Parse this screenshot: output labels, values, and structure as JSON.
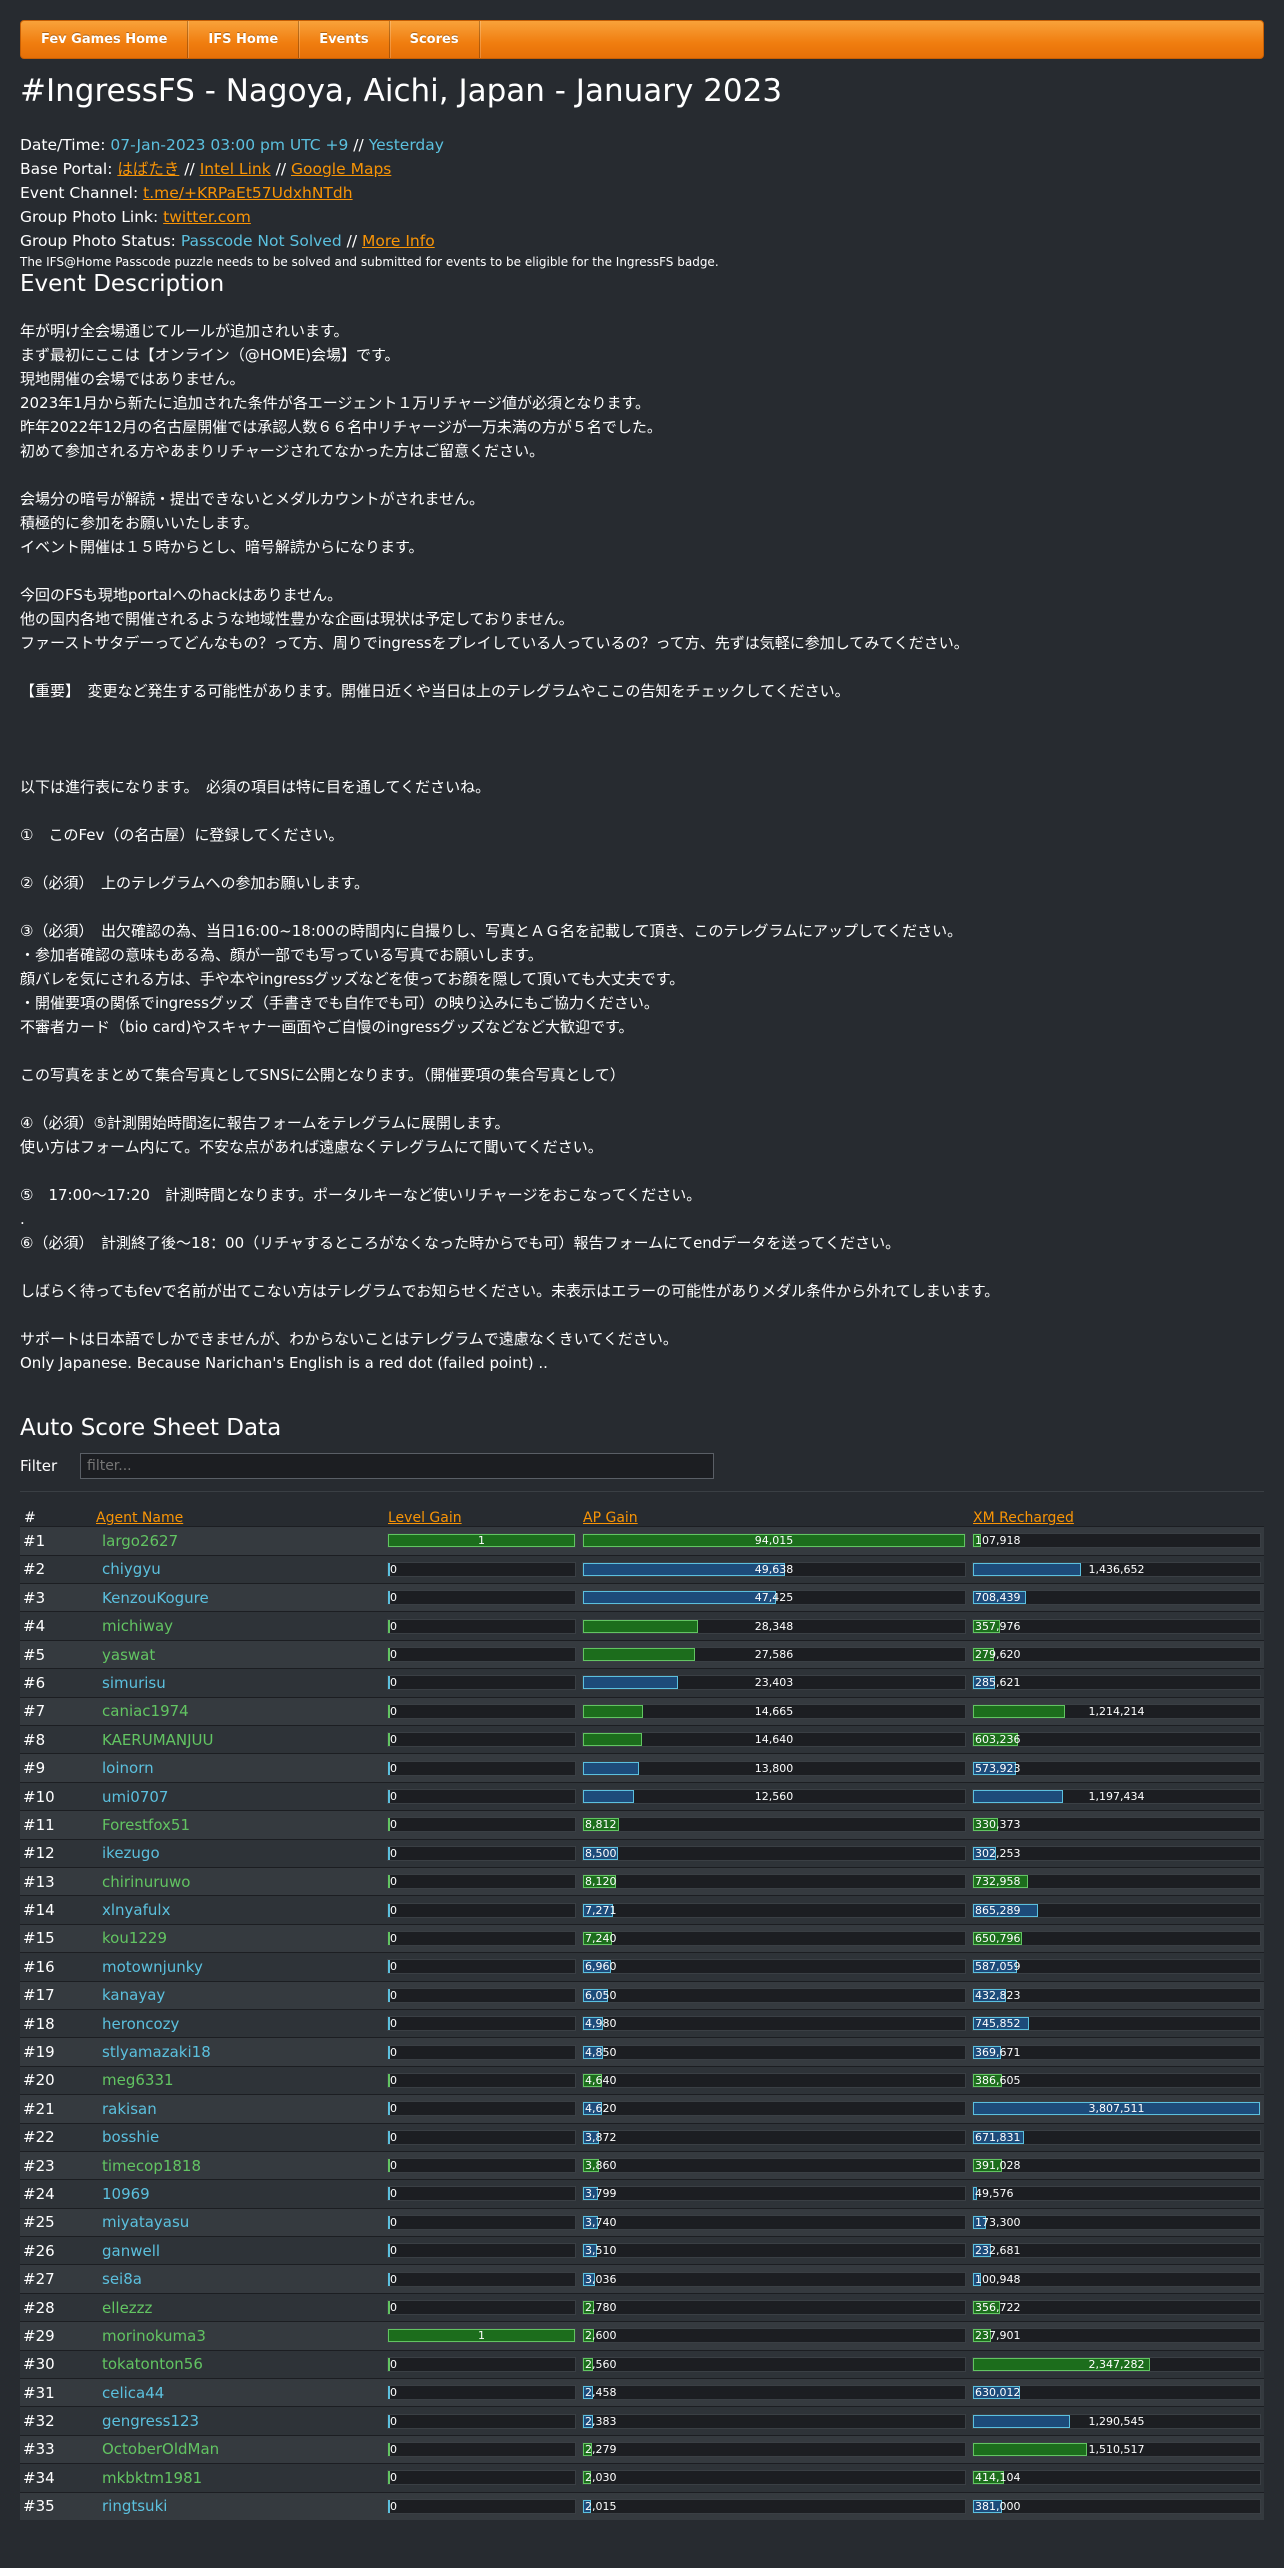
{
  "nav": [
    "Fev Games Home",
    "IFS Home",
    "Events",
    "Scores"
  ],
  "page_title": "#IngressFS - Nagoya, Aichi, Japan - January 2023",
  "info": {
    "datetime_label": "Date/Time: ",
    "datetime_value": "07-Jan-2023 03:00 pm UTC +9",
    "datetime_sep": " // ",
    "datetime_rel": "Yesterday",
    "portal_label": "Base Portal: ",
    "portal_name": "はばたき",
    "sep": " // ",
    "intel_link": "Intel Link",
    "maps_link": "Google Maps",
    "channel_label": "Event Channel: ",
    "channel_link": "t.me/+KRPaEt57UdxhNTdh",
    "photo_label": "Group Photo Link: ",
    "photo_link": "twitter.com",
    "status_label": "Group Photo Status: ",
    "status_value": "Passcode Not Solved",
    "more_info": "More Info",
    "note": "The IFS@Home Passcode puzzle needs to be solved and submitted for events to be eligible for the IngressFS badge."
  },
  "description_heading": "Event Description",
  "description": [
    "年が明け全会場通じてルールが追加されいます。",
    "まず最初にここは【オンライン（@HOME)会場】です。",
    "現地開催の会場ではありません。",
    "2023年1月から新たに追加された条件が各エージェント１万リチャージ値が必須となります。",
    "昨年2022年12月の名古屋開催では承認人数６６名中リチャージが一万未満の方が５名でした。",
    "初めて参加される方やあまりリチャージされてなかった方はご留意ください。",
    "",
    "会場分の暗号が解読・提出できないとメダルカウントがされません。",
    "積極的に参加をお願いいたします。",
    "イベント開催は１５時からとし、暗号解読からになります。",
    "",
    "今回のFSも現地portalへのhackはありません。",
    "他の国内各地で開催されるような地域性豊かな企画は現状は予定しておりません。",
    "ファーストサタデーってどんなもの？って方、周りでingressをプレイしている人っているの？って方、先ずは気軽に参加してみてください。",
    "",
    "【重要】　変更など発生する可能性があります。開催日近くや当日は上のテレグラムやここの告知をチェックしてください。",
    "",
    "",
    "",
    "以下は進行表になります。　必須の項目は特に目を通してくださいね。",
    "",
    "①　このFev（の名古屋）に登録してください。",
    "",
    "②（必須）　上のテレグラムへの参加お願いします。",
    "",
    "③（必須）　出欠確認の為、当日16:00~18:00の時間内に自撮りし、写真とＡＧ名を記載して頂き、このテレグラムにアップしてください。",
    "・参加者確認の意味もある為、顔が一部でも写っている写真でお願いします。",
    "顔バレを気にされる方は、手や本やingressグッズなどを使ってお顔を隠して頂いても大丈夫です。",
    "・開催要項の関係でingressグッズ（手書きでも自作でも可）の映り込みにもご協力ください。",
    "不審者カード（bio card)やスキャナー画面やご自慢のingressグッズなどなど大歓迎です。",
    "",
    "この写真をまとめて集合写真としてSNSに公開となります。（開催要項の集合写真として）",
    "",
    "④（必須）⑤計測開始時間迄に報告フォームをテレグラムに展開します。",
    "使い方はフォーム内にて。不安な点があれば遠慮なくテレグラムにて聞いてください。",
    "",
    "⑤　17:00～17:20　計測時間となります。ポータルキーなど使いリチャージをおこなってください。",
    ".",
    "⑥（必須）　計測終了後～18：00（リチャするところがなくなった時からでも可）報告フォームにてendデータを送ってください。",
    "",
    "しばらく待ってもfevで名前が出てこない方はテレグラムでお知らせください。未表示はエラーの可能性がありメダル条件から外れてしまいます。",
    "",
    "サポートは日本語でしかできませんが、わからないことはテレグラムで遠慮なくきいてください。",
    "Only Japanese. Because Narichan's English is a red dot (failed point) .."
  ],
  "score_title": "Auto Score Sheet Data",
  "filter_label": "Filter",
  "filter_placeholder": "filter...",
  "columns": [
    "#",
    "Agent Name",
    "Level Gain",
    "AP Gain",
    "XM Recharged"
  ],
  "colors": {
    "enl": "#62c462",
    "res": "#5bc0de",
    "accent": "#f89406",
    "bg": "#272b30"
  },
  "rows": [
    {
      "rank": "#1",
      "name": "largo2627",
      "faction": "enl",
      "level": 1,
      "ap": "94,015",
      "apv": 94015,
      "xm": "107,918",
      "xmv": 107918
    },
    {
      "rank": "#2",
      "name": "chiygyu",
      "faction": "res",
      "level": 0,
      "ap": "49,638",
      "apv": 49638,
      "xm": "1,436,652",
      "xmv": 1436652
    },
    {
      "rank": "#3",
      "name": "KenzouKogure",
      "faction": "res",
      "level": 0,
      "ap": "47,425",
      "apv": 47425,
      "xm": "708,439",
      "xmv": 708439
    },
    {
      "rank": "#4",
      "name": "michiway",
      "faction": "enl",
      "level": 0,
      "ap": "28,348",
      "apv": 28348,
      "xm": "357,976",
      "xmv": 357976
    },
    {
      "rank": "#5",
      "name": "yaswat",
      "faction": "enl",
      "level": 0,
      "ap": "27,586",
      "apv": 27586,
      "xm": "279,620",
      "xmv": 279620
    },
    {
      "rank": "#6",
      "name": "simurisu",
      "faction": "res",
      "level": 0,
      "ap": "23,403",
      "apv": 23403,
      "xm": "285,621",
      "xmv": 285621
    },
    {
      "rank": "#7",
      "name": "caniac1974",
      "faction": "enl",
      "level": 0,
      "ap": "14,665",
      "apv": 14665,
      "xm": "1,214,214",
      "xmv": 1214214
    },
    {
      "rank": "#8",
      "name": "KAERUMANJUU",
      "faction": "enl",
      "level": 0,
      "ap": "14,640",
      "apv": 14640,
      "xm": "603,236",
      "xmv": 603236
    },
    {
      "rank": "#9",
      "name": "loinorn",
      "faction": "res",
      "level": 0,
      "ap": "13,800",
      "apv": 13800,
      "xm": "573,923",
      "xmv": 573923
    },
    {
      "rank": "#10",
      "name": "umi0707",
      "faction": "res",
      "level": 0,
      "ap": "12,560",
      "apv": 12560,
      "xm": "1,197,434",
      "xmv": 1197434
    },
    {
      "rank": "#11",
      "name": "Forestfox51",
      "faction": "enl",
      "level": 0,
      "ap": "8,812",
      "apv": 8812,
      "xm": "330,373",
      "xmv": 330373
    },
    {
      "rank": "#12",
      "name": "ikezugo",
      "faction": "res",
      "level": 0,
      "ap": "8,500",
      "apv": 8500,
      "xm": "302,253",
      "xmv": 302253
    },
    {
      "rank": "#13",
      "name": "chirinuruwo",
      "faction": "enl",
      "level": 0,
      "ap": "8,120",
      "apv": 8120,
      "xm": "732,958",
      "xmv": 732958
    },
    {
      "rank": "#14",
      "name": "xlnyafulx",
      "faction": "res",
      "level": 0,
      "ap": "7,271",
      "apv": 7271,
      "xm": "865,289",
      "xmv": 865289
    },
    {
      "rank": "#15",
      "name": "kou1229",
      "faction": "enl",
      "level": 0,
      "ap": "7,240",
      "apv": 7240,
      "xm": "650,796",
      "xmv": 650796
    },
    {
      "rank": "#16",
      "name": "motownjunky",
      "faction": "res",
      "level": 0,
      "ap": "6,960",
      "apv": 6960,
      "xm": "587,059",
      "xmv": 587059
    },
    {
      "rank": "#17",
      "name": "kanayay",
      "faction": "res",
      "level": 0,
      "ap": "6,050",
      "apv": 6050,
      "xm": "432,823",
      "xmv": 432823
    },
    {
      "rank": "#18",
      "name": "heroncozy",
      "faction": "res",
      "level": 0,
      "ap": "4,980",
      "apv": 4980,
      "xm": "745,852",
      "xmv": 745852
    },
    {
      "rank": "#19",
      "name": "stlyamazaki18",
      "faction": "res",
      "level": 0,
      "ap": "4,850",
      "apv": 4850,
      "xm": "369,671",
      "xmv": 369671
    },
    {
      "rank": "#20",
      "name": "meg6331",
      "faction": "enl",
      "level": 0,
      "ap": "4,640",
      "apv": 4640,
      "xm": "386,605",
      "xmv": 386605
    },
    {
      "rank": "#21",
      "name": "rakisan",
      "faction": "res",
      "level": 0,
      "ap": "4,620",
      "apv": 4620,
      "xm": "3,807,511",
      "xmv": 3807511
    },
    {
      "rank": "#22",
      "name": "bosshie",
      "faction": "res",
      "level": 0,
      "ap": "3,872",
      "apv": 3872,
      "xm": "671,831",
      "xmv": 671831
    },
    {
      "rank": "#23",
      "name": "timecop1818",
      "faction": "enl",
      "level": 0,
      "ap": "3,860",
      "apv": 3860,
      "xm": "391,028",
      "xmv": 391028
    },
    {
      "rank": "#24",
      "name": "10969",
      "faction": "res",
      "level": 0,
      "ap": "3,799",
      "apv": 3799,
      "xm": "49,576",
      "xmv": 49576
    },
    {
      "rank": "#25",
      "name": "miyatayasu",
      "faction": "res",
      "level": 0,
      "ap": "3,740",
      "apv": 3740,
      "xm": "173,300",
      "xmv": 173300
    },
    {
      "rank": "#26",
      "name": "ganwell",
      "faction": "res",
      "level": 0,
      "ap": "3,510",
      "apv": 3510,
      "xm": "232,681",
      "xmv": 232681
    },
    {
      "rank": "#27",
      "name": "sei8a",
      "faction": "res",
      "level": 0,
      "ap": "3,036",
      "apv": 3036,
      "xm": "100,948",
      "xmv": 100948
    },
    {
      "rank": "#28",
      "name": "ellezzz",
      "faction": "enl",
      "level": 0,
      "ap": "2,780",
      "apv": 2780,
      "xm": "356,722",
      "xmv": 356722
    },
    {
      "rank": "#29",
      "name": "morinokuma3",
      "faction": "enl",
      "level": 1,
      "ap": "2,600",
      "apv": 2600,
      "xm": "237,901",
      "xmv": 237901
    },
    {
      "rank": "#30",
      "name": "tokatonton56",
      "faction": "enl",
      "level": 0,
      "ap": "2,560",
      "apv": 2560,
      "xm": "2,347,282",
      "xmv": 2347282
    },
    {
      "rank": "#31",
      "name": "celica44",
      "faction": "res",
      "level": 0,
      "ap": "2,458",
      "apv": 2458,
      "xm": "630,012",
      "xmv": 630012
    },
    {
      "rank": "#32",
      "name": "gengress123",
      "faction": "res",
      "level": 0,
      "ap": "2,383",
      "apv": 2383,
      "xm": "1,290,545",
      "xmv": 1290545
    },
    {
      "rank": "#33",
      "name": "OctoberOldMan",
      "faction": "enl",
      "level": 0,
      "ap": "2,279",
      "apv": 2279,
      "xm": "1,510,517",
      "xmv": 1510517
    },
    {
      "rank": "#34",
      "name": "mkbktm1981",
      "faction": "enl",
      "level": 0,
      "ap": "2,030",
      "apv": 2030,
      "xm": "414,104",
      "xmv": 414104
    },
    {
      "rank": "#35",
      "name": "ringtsuki",
      "faction": "res",
      "level": 0,
      "ap": "2,015",
      "apv": 2015,
      "xm": "381,000",
      "xmv": 381000
    }
  ]
}
